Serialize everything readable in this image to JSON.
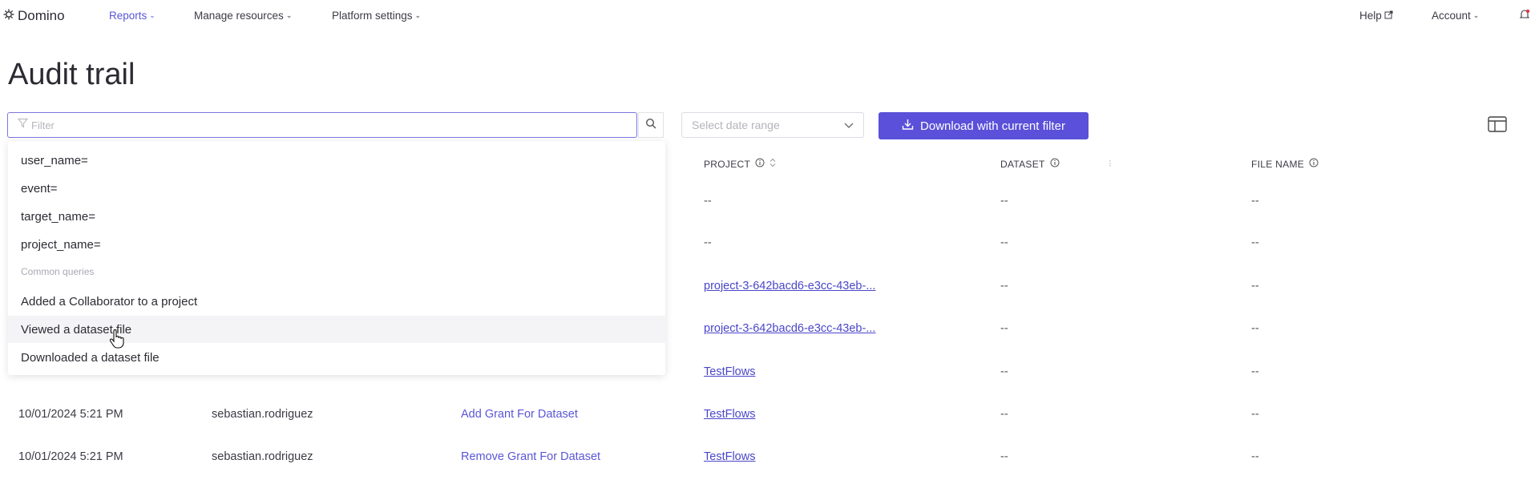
{
  "nav": {
    "brand": "Domino",
    "items": [
      {
        "label": "Reports",
        "active": true
      },
      {
        "label": "Manage resources"
      },
      {
        "label": "Platform settings"
      }
    ],
    "help": "Help",
    "account": "Account"
  },
  "page": {
    "title": "Audit trail"
  },
  "toolbar": {
    "filter_placeholder": "Filter",
    "date_placeholder": "Select date range",
    "download_label": "Download with current filter"
  },
  "table": {
    "headers": {
      "project": "PROJECT",
      "dataset": "DATASET",
      "file_name": "FILE NAME"
    },
    "rows": [
      {
        "date": "",
        "user": "",
        "event": "",
        "project": "--",
        "dataset": "--",
        "file": "--"
      },
      {
        "date": "",
        "user": "",
        "event": "",
        "project": "--",
        "dataset": "--",
        "file": "--"
      },
      {
        "date": "",
        "user": "",
        "event": "",
        "project": "project-3-642bacd6-e3cc-43eb-...",
        "dataset": "--",
        "file": "--"
      },
      {
        "date": "",
        "user": "",
        "event": "",
        "project": "project-3-642bacd6-e3cc-43eb-...",
        "dataset": "--",
        "file": "--"
      },
      {
        "date": "",
        "user": "",
        "event": "",
        "project": "TestFlows",
        "dataset": "--",
        "file": "--"
      },
      {
        "date": "10/01/2024 5:21 PM",
        "user": "sebastian.rodriguez",
        "event": "Add Grant For Dataset",
        "project": "TestFlows",
        "dataset": "--",
        "file": "--"
      },
      {
        "date": "10/01/2024 5:21 PM",
        "user": "sebastian.rodriguez",
        "event": "Remove Grant For Dataset",
        "project": "TestFlows",
        "dataset": "--",
        "file": "--"
      }
    ]
  },
  "dropdown": {
    "options": [
      "user_name=",
      "event=",
      "target_name=",
      "project_name="
    ],
    "section_header": "Common queries",
    "queries": [
      "Added a Collaborator to a project",
      "Viewed a dataset file",
      "Downloaded a dataset file"
    ]
  }
}
